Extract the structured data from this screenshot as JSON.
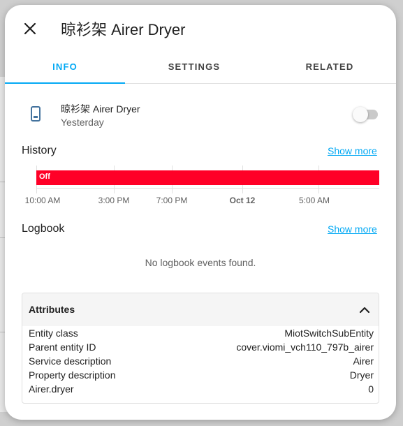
{
  "dialog": {
    "title": "晾衫架 Airer Dryer"
  },
  "tabs": [
    {
      "label": "INFO",
      "active": true
    },
    {
      "label": "SETTINGS",
      "active": false
    },
    {
      "label": "RELATED",
      "active": false
    }
  ],
  "entity": {
    "name": "晾衫架 Airer Dryer",
    "last_changed": "Yesterday",
    "icon": "cellphone-icon",
    "toggle_state": "off"
  },
  "history": {
    "title": "History",
    "show_more": "Show more",
    "state_label": "Off",
    "state_color": "#ff0027",
    "ticks": [
      "10:00 AM",
      "3:00 PM",
      "7:00 PM",
      "Oct 12",
      "5:00 AM"
    ]
  },
  "logbook": {
    "title": "Logbook",
    "show_more": "Show more",
    "empty_text": "No logbook events found."
  },
  "attributes": {
    "title": "Attributes",
    "rows": [
      {
        "key": "Entity class",
        "value": "MiotSwitchSubEntity"
      },
      {
        "key": "Parent entity ID",
        "value": "cover.viomi_vch110_797b_airer"
      },
      {
        "key": "Service description",
        "value": "Airer"
      },
      {
        "key": "Property description",
        "value": "Dryer"
      },
      {
        "key": "Airer.dryer",
        "value": "0"
      }
    ]
  },
  "colors": {
    "accent": "#03a9f4",
    "icon": "#44739e"
  }
}
